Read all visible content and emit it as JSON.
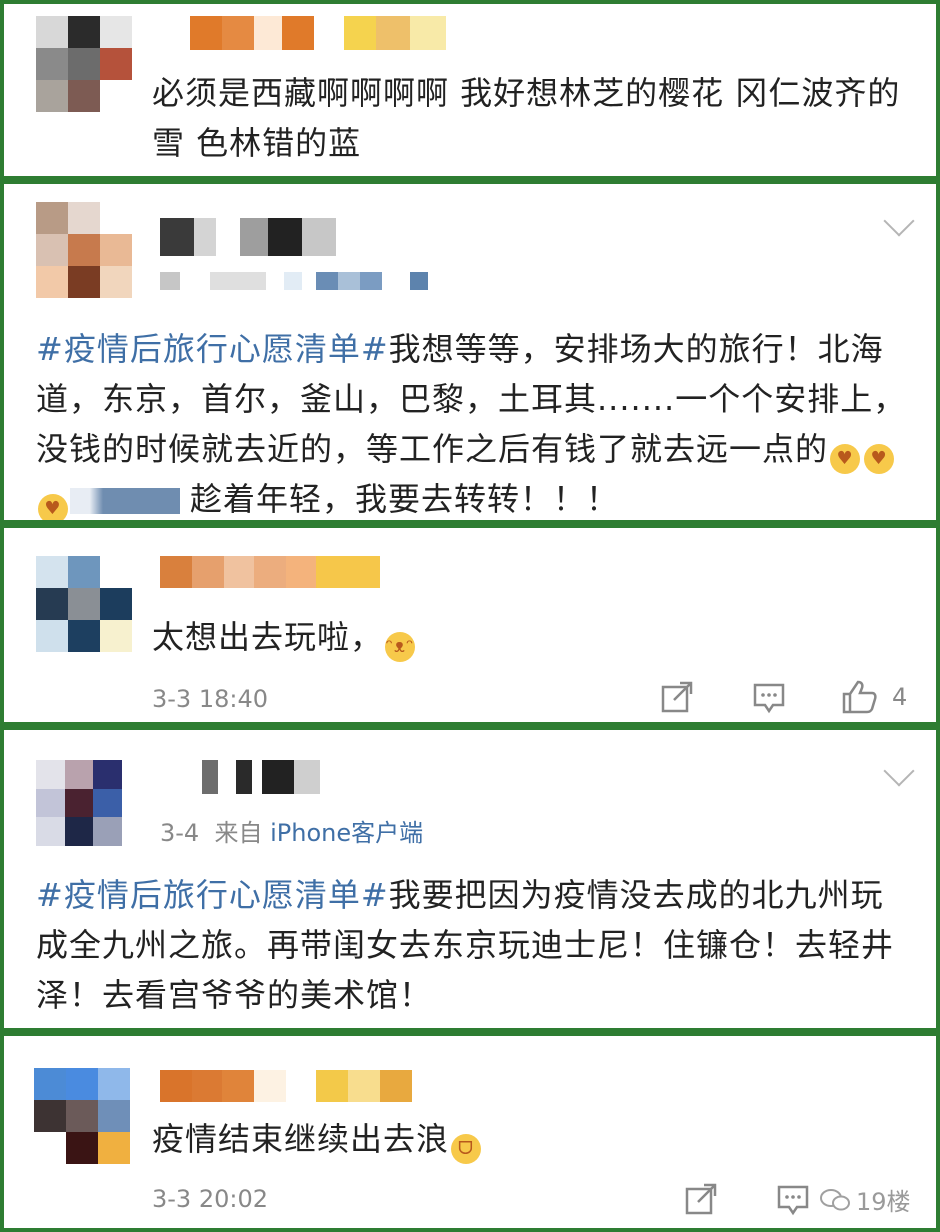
{
  "comments": [
    {
      "text": "必须是西藏啊啊啊啊 我好想林芝的樱花 冈仁波齐的雪 色林错的蓝"
    },
    {
      "hashtag": "#疫情后旅行心愿清单#",
      "text": "我想等等，安排场大的旅行！北海道，东京，首尔，釜山，巴黎，土耳其.......一个个安排上，没钱的时候就去近的，等工作之后有钱了就去远一点的",
      "text_after": "趁着年轻，我要去转转！！！"
    },
    {
      "text": "太想出去玩啦，",
      "time": "3-3 18:40",
      "likes": "4"
    },
    {
      "date": "3-4",
      "source_prefix": "来自",
      "source": "iPhone客户端",
      "hashtag": "#疫情后旅行心愿清单#",
      "text": "我要把因为疫情没去成的北九州玩成全九州之旅。再带闺女去东京玩迪士尼！住镰仓！去轻井泽！去看宫爷爷的美术馆！"
    },
    {
      "text": "疫情结束继续出去浪",
      "time": "3-3 20:02"
    }
  ],
  "watermark": "19楼",
  "icons": {
    "more": "chevron-down-icon",
    "share": "share-icon",
    "comment": "comment-icon",
    "like": "like-icon"
  },
  "colors": {
    "border": "#2e7d32",
    "hashtag": "#3f6fa6",
    "meta": "#888888"
  }
}
